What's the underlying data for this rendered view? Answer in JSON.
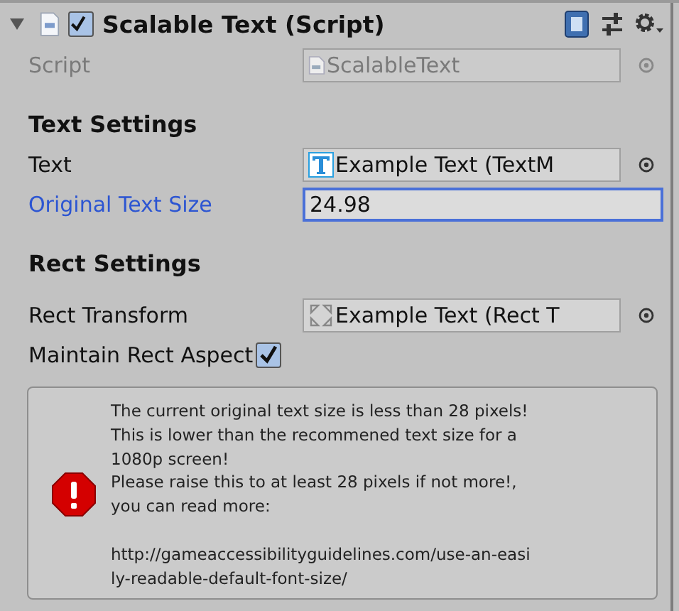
{
  "component": {
    "title": "Scalable Text (Script)",
    "expanded": true,
    "enabled": true
  },
  "script_field": {
    "label": "Script",
    "value": "ScalableText",
    "disabled": true
  },
  "sections": [
    {
      "heading": "Text Settings",
      "fields": [
        {
          "kind": "textref",
          "label": "Text",
          "value": "Example Text (TextM",
          "focused": false
        },
        {
          "kind": "number",
          "label": "Original Text Size",
          "value": "24.98",
          "focused": true
        }
      ]
    },
    {
      "heading": "Rect Settings",
      "fields": [
        {
          "kind": "rectref",
          "label": "Rect Transform",
          "value": "Example Text (Rect T",
          "focused": false
        },
        {
          "kind": "toggle",
          "label": "Maintain Rect Aspect",
          "checked": true
        }
      ]
    }
  ],
  "help_box": {
    "kind": "error",
    "message": "The current original text size is less than 28 pixels!\nThis is lower than the recommened text size for a\n1080p screen!\nPlease raise this to at least 28 pixels if not more!,\nyou can read more:\n\nhttp://gameaccessibilityguidelines.com/use-an-easi\nly-readable-default-font-size/"
  }
}
